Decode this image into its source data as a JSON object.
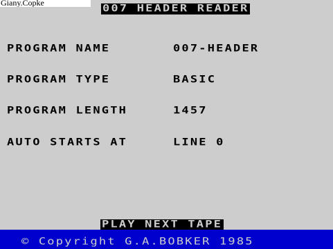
{
  "window": {
    "caption": "Giany.Copke"
  },
  "header": {
    "title": "007 HEADER READER"
  },
  "fields": [
    {
      "label": "PROGRAM NAME",
      "value": "007-HEADER"
    },
    {
      "label": "PROGRAM TYPE",
      "value": "BASIC"
    },
    {
      "label": "PROGRAM LENGTH",
      "value": "1457"
    },
    {
      "label": "AUTO STARTS AT",
      "value": "LINE 0"
    }
  ],
  "prompt": {
    "text": "PLAY NEXT TAPE"
  },
  "footer": {
    "copyright": "© Copyright G.A.BOBKER 1985"
  },
  "colors": {
    "screen_background": "#cdcdcd",
    "inverse_background": "#000000",
    "footer_band": "#0000cd",
    "text": "#000000"
  }
}
